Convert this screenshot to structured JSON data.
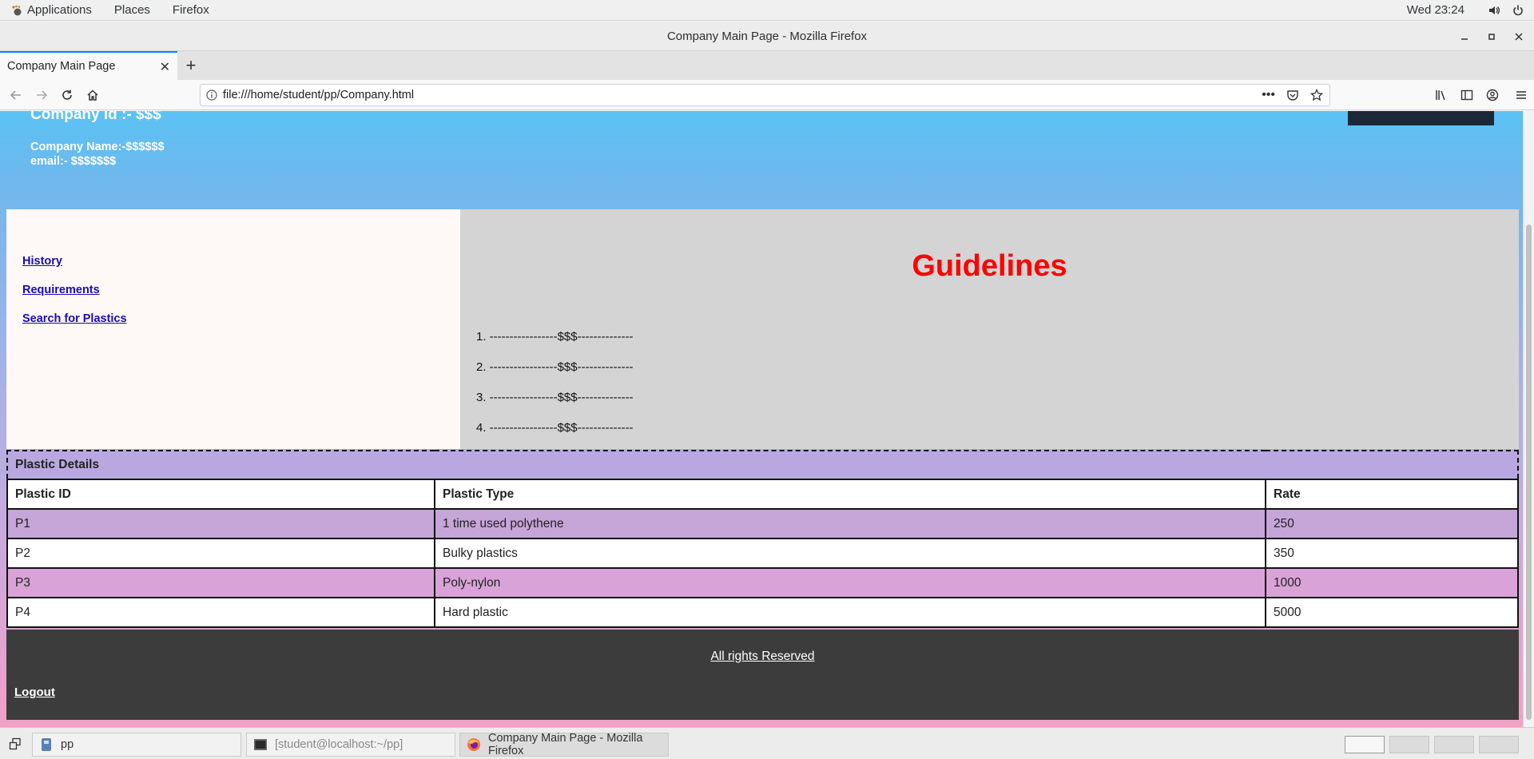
{
  "topbar": {
    "applications_label": "Applications",
    "places_label": "Places",
    "firefox_label": "Firefox",
    "clock": "Wed 23:24",
    "icons": [
      "volume-icon",
      "power-icon"
    ]
  },
  "window": {
    "title": "Company Main Page - Mozilla Firefox"
  },
  "tabs": [
    {
      "label": "Company Main Page",
      "active": true
    }
  ],
  "navbar": {
    "url": "file:///home/student/pp/Company.html"
  },
  "page": {
    "header": {
      "company_id": "Company id :- $$$",
      "company_name": "Company Name:-$$$$$$",
      "email": "email:- $$$$$$$"
    },
    "sidebar": {
      "links": [
        {
          "label": "History"
        },
        {
          "label": "Requirements"
        },
        {
          "label": "Search for Plastics"
        }
      ]
    },
    "guidelines": {
      "title": "Guidelines",
      "items": [
        "1. -----------------$$$--------------",
        "2. -----------------$$$--------------",
        "3. -----------------$$$--------------",
        "4. -----------------$$$--------------"
      ]
    },
    "plastic_table": {
      "caption": "Plastic Details",
      "headers": [
        "Plastic ID",
        "Plastic Type",
        "Rate"
      ],
      "rows": [
        [
          "P1",
          "1 time used polythene",
          "250"
        ],
        [
          "P2",
          "Bulky plastics",
          "350"
        ],
        [
          "P3",
          "Poly-nylon",
          "1000"
        ],
        [
          "P4",
          "Hard plastic",
          "5000"
        ]
      ]
    },
    "footer": {
      "rights": "All rights Reserved",
      "logout": "Logout"
    },
    "colors": {
      "guidelines_title": "#ff0000",
      "header_text": "#ffffff",
      "footer_bg": "#3c3c3c"
    }
  },
  "taskbar": {
    "tasks": [
      {
        "label": "pp",
        "icon": "file-manager-icon"
      },
      {
        "label": "[student@localhost:~/pp]",
        "icon": "terminal-icon"
      },
      {
        "label": "Company Main Page - Mozilla Firefox",
        "icon": "firefox-icon"
      }
    ]
  }
}
